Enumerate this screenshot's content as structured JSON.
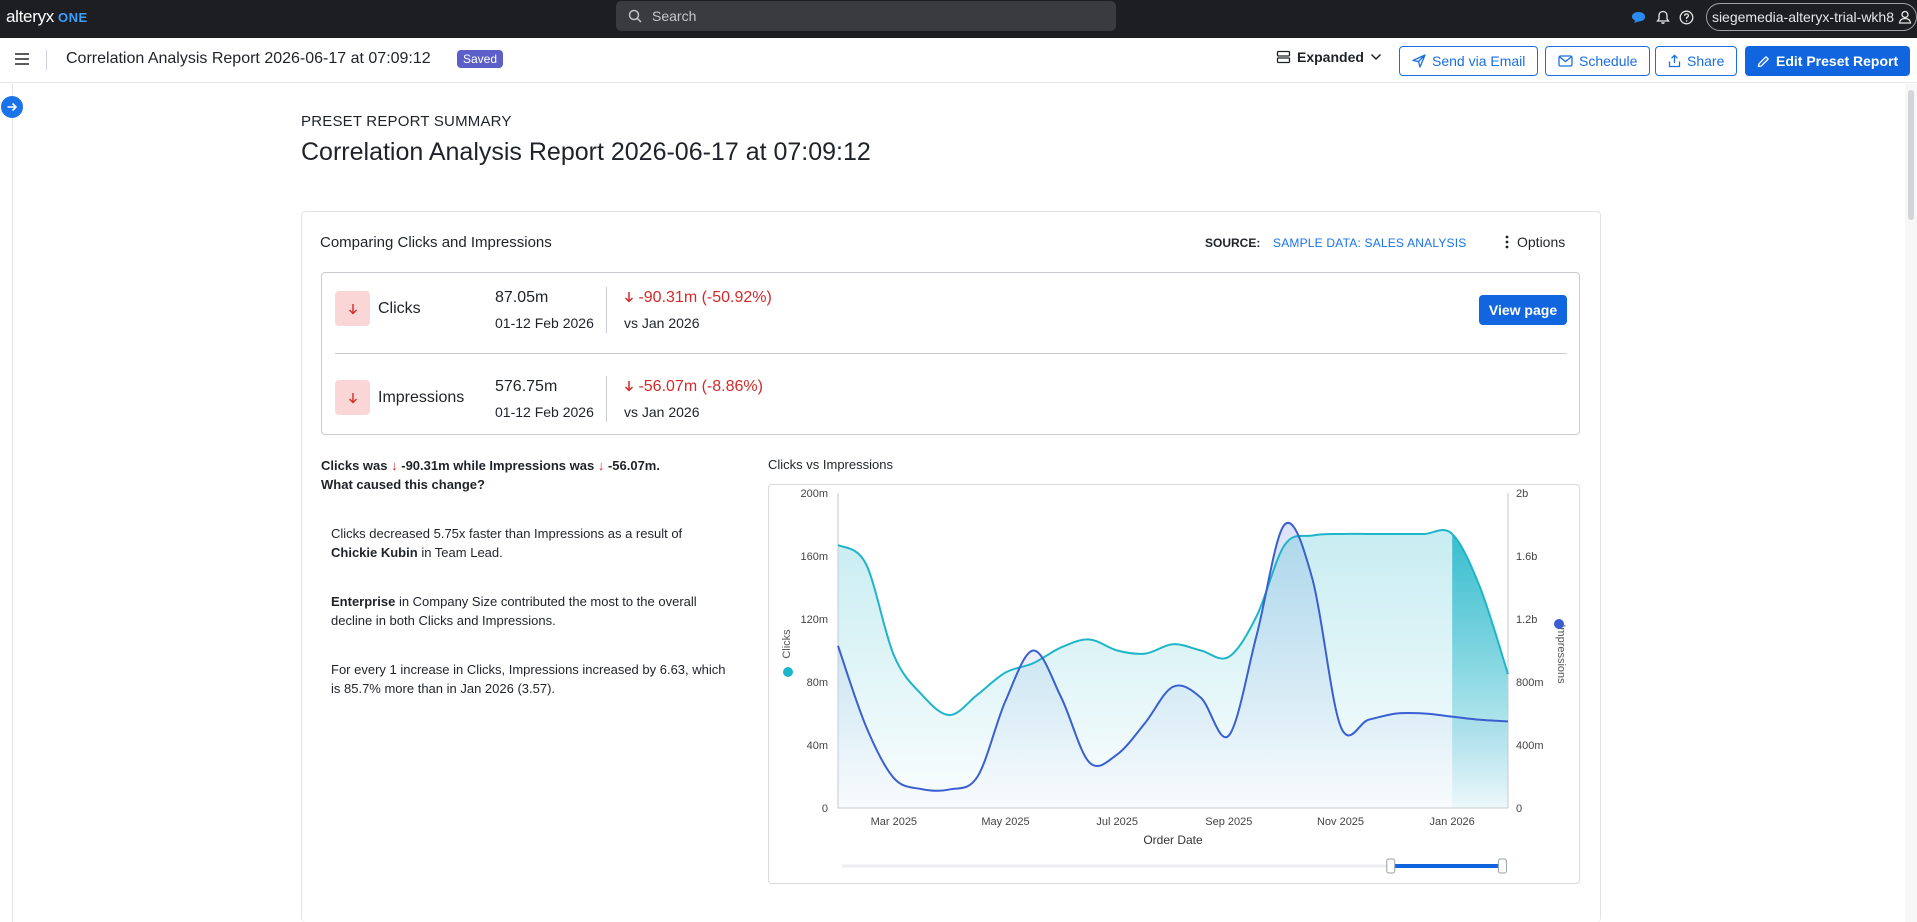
{
  "topbar": {
    "brand": "alteryx",
    "brand_suffix": "ONE",
    "search_placeholder": "Search",
    "account": "siegemedia-alteryx-trial-wkh8"
  },
  "header": {
    "title": "Correlation Analysis Report 2026-06-17 at 07:09:12",
    "status": "Saved",
    "view_mode": "Expanded",
    "send_email": "Send via Email",
    "schedule": "Schedule",
    "share": "Share",
    "edit": "Edit Preset Report"
  },
  "page": {
    "kicker": "PRESET REPORT SUMMARY",
    "heading": "Correlation Analysis Report 2026-06-17 at 07:09:12"
  },
  "card": {
    "title": "Comparing Clicks and Impressions",
    "source_label": "SOURCE:",
    "source_value": "SAMPLE DATA: SALES ANALYSIS",
    "options": "Options",
    "view_page": "View page"
  },
  "metrics": [
    {
      "name": "Clicks",
      "value": "87.05m",
      "period": "01-12 Feb 2026",
      "change": "-90.31m (-50.92%)",
      "compare": "vs Jan 2026"
    },
    {
      "name": "Impressions",
      "value": "576.75m",
      "period": "01-12 Feb 2026",
      "change": "-56.07m (-8.86%)",
      "compare": "vs Jan 2026"
    }
  ],
  "insights": {
    "q_part1": "Clicks was",
    "q_val1": "-90.31m",
    "q_part2": "while Impressions was",
    "q_val2": "-56.07m.",
    "q_line2": "What caused this change?",
    "i1_a": "Clicks decreased 5.75x faster than Impressions as a result of",
    "i1_b": "Chickie Kubin",
    "i1_c": "in Team Lead.",
    "i2_a": "Enterprise",
    "i2_b": "in Company Size contributed the most to the overall decline in both Clicks and Impressions.",
    "i3": "For every 1 increase in Clicks, Impressions increased by 6.63, which is 85.7% more than in Jan 2026 (3.57)."
  },
  "colors": {
    "clicks": "#1fb5c8",
    "impressions": "#3a5fd0",
    "accent": "#1166e0",
    "negative": "#d42a2a"
  },
  "chart_data": {
    "type": "line",
    "title": "Clicks vs Impressions",
    "xlabel": "Order Date",
    "ylabel_left": "Clicks",
    "ylabel_right": "Impressions",
    "left_ticks": [
      "0",
      "40m",
      "80m",
      "120m",
      "160m",
      "200m"
    ],
    "right_ticks": [
      "0",
      "400m",
      "800m",
      "1.2b",
      "1.6b",
      "2b"
    ],
    "x_ticks": [
      "Mar 2025",
      "May 2025",
      "Jul 2025",
      "Sep 2025",
      "Nov 2025",
      "Jan 2026"
    ],
    "ylim_left": [
      0,
      200
    ],
    "ylim_right": [
      0,
      2000
    ],
    "x": [
      1,
      1.5,
      2,
      2.5,
      3,
      3.5,
      4,
      4.5,
      5,
      5.5,
      6,
      6.5,
      7,
      7.5,
      8,
      8.5,
      9,
      9.5,
      10,
      10.5,
      11,
      11.5,
      12,
      12.5,
      13
    ],
    "series": [
      {
        "name": "Clicks",
        "axis": "left",
        "values": [
          167,
          155,
          97,
          72,
          59,
          72,
          86,
          92,
          102,
          107,
          100,
          98,
          104,
          100,
          96,
          122,
          167,
          173,
          174,
          174,
          174,
          174,
          174,
          140,
          85
        ]
      },
      {
        "name": "Impressions",
        "axis": "right",
        "values": [
          1030,
          520,
          190,
          120,
          118,
          200,
          680,
          1000,
          700,
          290,
          340,
          540,
          770,
          700,
          460,
          1100,
          1800,
          1450,
          520,
          560,
          600,
          600,
          580,
          560,
          550
        ]
      }
    ],
    "shaded_from_x": 12,
    "grid": false,
    "legend": "axis-labels"
  }
}
